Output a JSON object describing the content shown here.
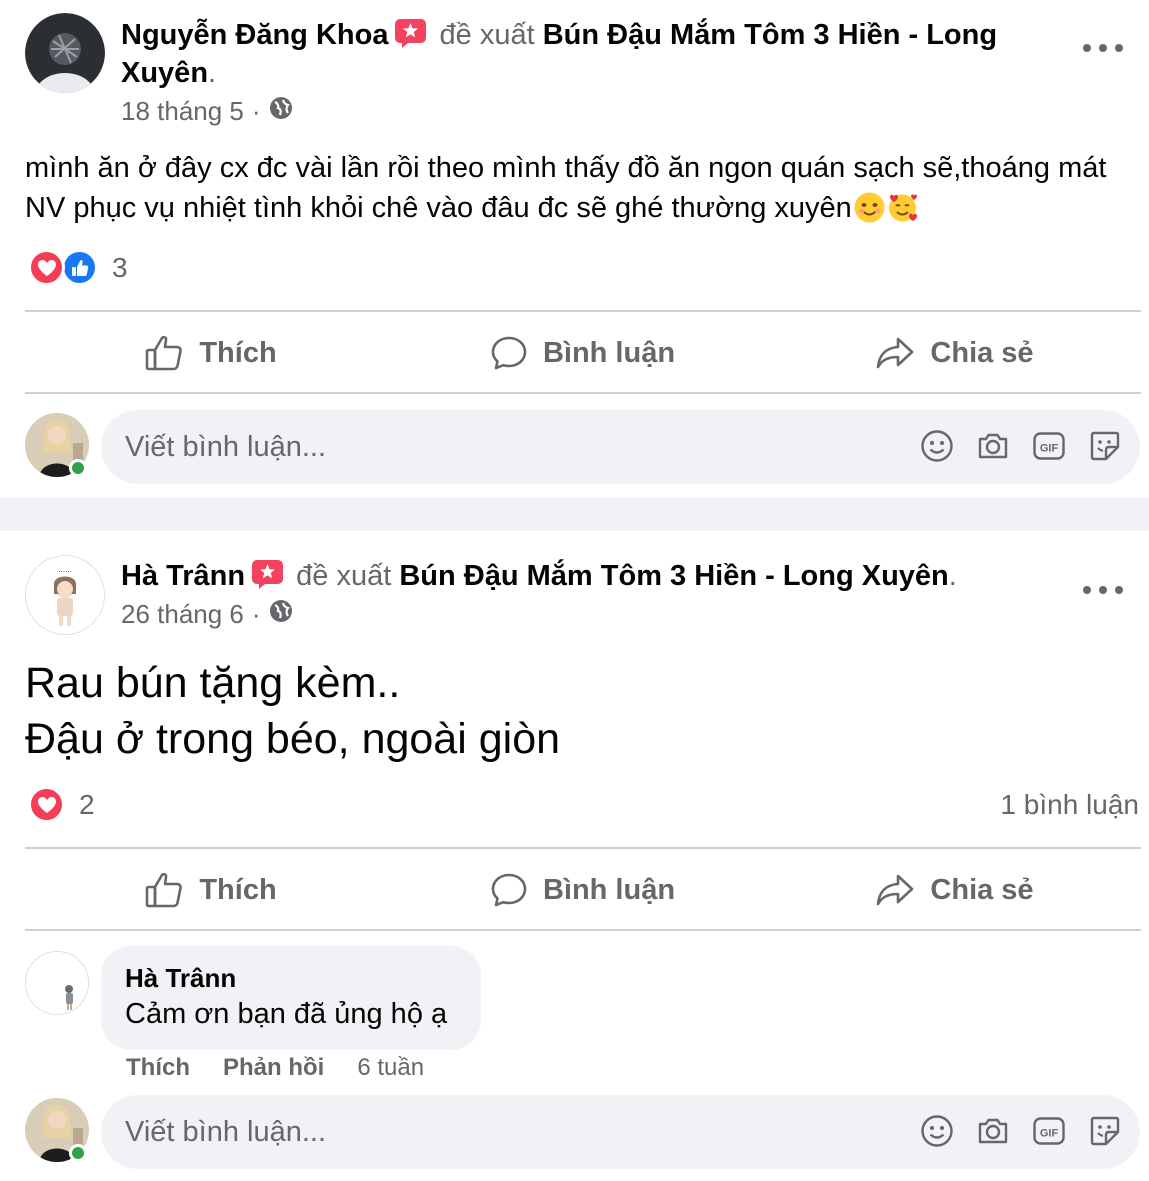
{
  "colors": {
    "text_primary": "#050505",
    "text_secondary": "#65676b",
    "love": "#f33e58",
    "like": "#1877f2",
    "online": "#31a24c",
    "recommend_badge": "#f3425f",
    "separator": "#f0f2f5"
  },
  "posts": [
    {
      "author": "Nguyễn Đăng Khoa",
      "verb": "đề xuất",
      "page_name": "Bún Đậu Mắm Tôm 3 Hiền - Long Xuyên",
      "trailing": ".",
      "date": "18 tháng 5",
      "separator": "·",
      "privacy_icon": "globe-icon",
      "text": "mình ăn ở đây cx đc vài lần rồi theo mình thấy đồ ăn ngon quán sạch sẽ,thoáng mát NV phục vụ nhiệt tình khỏi chê vào đâu đc sẽ ghé thường xuyên",
      "emojis": [
        "smiling-face-icon",
        "smiling-face-with-hearts-icon"
      ],
      "reactions": [
        "love",
        "like"
      ],
      "reaction_count": "3",
      "actions": {
        "like": "Thích",
        "comment": "Bình luận",
        "share": "Chia sẻ"
      },
      "composer_placeholder": "Viết bình luận..."
    },
    {
      "author": "Hà Trânn",
      "verb": "đề xuất",
      "page_name": "Bún Đậu Mắm Tôm 3 Hiền - Long Xuyên",
      "trailing": ".",
      "date": "26 tháng 6",
      "separator": "·",
      "privacy_icon": "globe-icon",
      "text_line1": "Rau bún tặng kèm..",
      "text_line2": "Đậu ở trong béo, ngoài giòn",
      "reactions": [
        "love"
      ],
      "reaction_count": "2",
      "comment_count": "1 bình luận",
      "actions": {
        "like": "Thích",
        "comment": "Bình luận",
        "share": "Chia sẻ"
      },
      "comment": {
        "author": "Hà Trânn",
        "text": "Cảm ơn bạn đã ủng hộ ạ",
        "like": "Thích",
        "reply": "Phản hồi",
        "time": "6 tuần"
      },
      "composer_placeholder": "Viết bình luận..."
    }
  ]
}
